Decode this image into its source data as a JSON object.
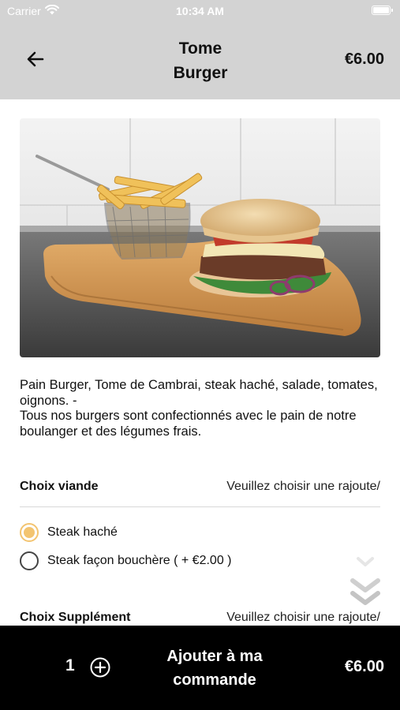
{
  "status_bar": {
    "carrier": "Carrier",
    "time": "10:34 AM",
    "icons": [
      "wifi-icon",
      "battery-icon"
    ]
  },
  "header": {
    "title": "Tome\nBurger",
    "price": "€6.00",
    "back_icon": "arrow-left-icon"
  },
  "product": {
    "image": "burger-with-fries-photo",
    "description": "Pain Burger, Tome de Cambrai, steak haché, salade, tomates, oignons. -\nTous nos burgers sont confectionnés avec le pain de notre boulanger et des légumes frais."
  },
  "sections": [
    {
      "label": "Choix viande",
      "hint": "Veuillez choisir une rajoute/",
      "options": [
        {
          "label": "Steak haché",
          "selected": true
        },
        {
          "label": "Steak façon bouchère ( + €2.00 )",
          "selected": false
        }
      ]
    },
    {
      "label": "Choix Supplément",
      "hint": "Veuillez choisir une rajoute/"
    }
  ],
  "bottom_bar": {
    "quantity": "1",
    "cta": "Ajouter à ma\ncommande",
    "total": "€6.00",
    "plus_icon": "plus-circle-icon"
  },
  "colors": {
    "header_bg": "#d3d3d3",
    "accent": "#f3c470",
    "bottom_bar_bg": "#000000"
  }
}
